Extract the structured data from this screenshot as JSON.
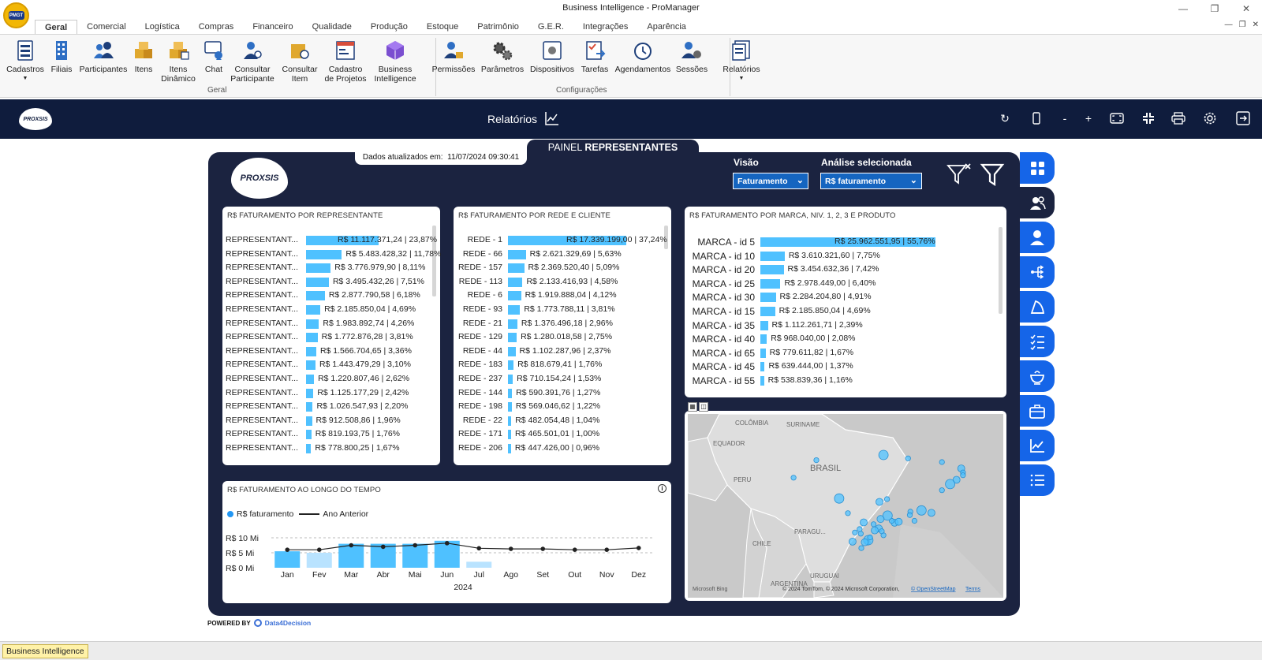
{
  "window": {
    "title": "Business Intelligence - ProManager",
    "logo_text": "PMGT",
    "controls": [
      "minimize",
      "restore",
      "close"
    ]
  },
  "ribbon": {
    "tabs": [
      "Geral",
      "Comercial",
      "Logística",
      "Compras",
      "Financeiro",
      "Qualidade",
      "Produção",
      "Estoque",
      "Patrimônio",
      "G.E.R.",
      "Integrações",
      "Aparência"
    ],
    "active_tab": "Geral",
    "geral_items": [
      {
        "label": "Cadastros",
        "icon": "form-icon",
        "dropdown": true
      },
      {
        "label": "Filiais",
        "icon": "building-icon"
      },
      {
        "label": "Participantes",
        "icon": "people-icon"
      },
      {
        "label": "Itens",
        "icon": "boxes-icon"
      },
      {
        "label": "Itens\nDinâmico",
        "icon": "boxes-grid-icon"
      },
      {
        "label": "Chat",
        "icon": "chat-icon"
      },
      {
        "label": "Consultar\nParticipante",
        "icon": "person-search-icon"
      },
      {
        "label": "Consultar\nItem",
        "icon": "box-search-icon"
      },
      {
        "label": "Cadastro\nde Projetos",
        "icon": "projects-icon"
      },
      {
        "label": "Business\nIntelligence",
        "icon": "bi-cube-icon"
      }
    ],
    "geral_group_label": "Geral",
    "config_items": [
      {
        "label": "Permissões",
        "icon": "permissions-icon"
      },
      {
        "label": "Parâmetros",
        "icon": "gears-icon"
      },
      {
        "label": "Dispositivos",
        "icon": "device-icon"
      },
      {
        "label": "Tarefas",
        "icon": "tasks-icon"
      },
      {
        "label": "Agendamentos",
        "icon": "alarm-clock-icon"
      },
      {
        "label": "Sessões",
        "icon": "sessions-icon"
      }
    ],
    "config_group_label": "Configurações",
    "reports_item": {
      "label": "Relatórios",
      "icon": "reports-icon",
      "dropdown": true
    }
  },
  "bi_header": {
    "logo_text": "PROXSIS",
    "title": "Relatórios",
    "tools": [
      "refresh-icon",
      "mobile-icon",
      "zoom-out-icon",
      "zoom-in-icon",
      "fit-screen-icon",
      "collapse-icon",
      "print-icon",
      "settings-icon",
      "exit-icon"
    ],
    "zoom_out_label": "-",
    "zoom_in_label": "+"
  },
  "report": {
    "panel_title_prefix": "PAINEL ",
    "panel_title_bold": "REPRESENTANTES",
    "updated_label": "Dados atualizados em:",
    "updated_value": "11/07/2024 09:30:41",
    "logo_text": "PROXSIS",
    "visao_label": "Visão",
    "visao_value": "Faturamento",
    "analise_label": "Análise selecionada",
    "analise_value": "R$ faturamento",
    "powered_label": "POWERED BY",
    "powered_brand": "Data4Decision"
  },
  "charts": {
    "rep": {
      "title": "R$ FATURAMENTO POR REPRESENTANTE",
      "rows": [
        {
          "label": "REPRESENTANT...",
          "value": "R$ 11.117.371,24 | 23,87%",
          "pct": 23.87
        },
        {
          "label": "REPRESENTANT...",
          "value": "R$ 5.483.428,32 | 11,78%",
          "pct": 11.78
        },
        {
          "label": "REPRESENTANT...",
          "value": "R$ 3.776.979,90 | 8,11%",
          "pct": 8.11
        },
        {
          "label": "REPRESENTANT...",
          "value": "R$ 3.495.432,26 | 7,51%",
          "pct": 7.51
        },
        {
          "label": "REPRESENTANT...",
          "value": "R$ 2.877.790,58 | 6,18%",
          "pct": 6.18
        },
        {
          "label": "REPRESENTANT...",
          "value": "R$ 2.185.850,04 | 4,69%",
          "pct": 4.69
        },
        {
          "label": "REPRESENTANT...",
          "value": "R$ 1.983.892,74 | 4,26%",
          "pct": 4.26
        },
        {
          "label": "REPRESENTANT...",
          "value": "R$ 1.772.876,28 | 3,81%",
          "pct": 3.81
        },
        {
          "label": "REPRESENTANT...",
          "value": "R$ 1.566.704,65 | 3,36%",
          "pct": 3.36
        },
        {
          "label": "REPRESENTANT...",
          "value": "R$ 1.443.479,29 | 3,10%",
          "pct": 3.1
        },
        {
          "label": "REPRESENTANT...",
          "value": "R$ 1.220.807,46 | 2,62%",
          "pct": 2.62
        },
        {
          "label": "REPRESENTANT...",
          "value": "R$ 1.125.177,29 | 2,42%",
          "pct": 2.42
        },
        {
          "label": "REPRESENTANT...",
          "value": "R$ 1.026.547,93 | 2,20%",
          "pct": 2.2
        },
        {
          "label": "REPRESENTANT...",
          "value": "R$ 912.508,86 | 1,96%",
          "pct": 1.96
        },
        {
          "label": "REPRESENTANT...",
          "value": "R$ 819.193,75 | 1,76%",
          "pct": 1.76
        },
        {
          "label": "REPRESENTANT...",
          "value": "R$ 778.800,25 | 1,67%",
          "pct": 1.67
        }
      ]
    },
    "rede": {
      "title": "R$ FATURAMENTO POR REDE E CLIENTE",
      "rows": [
        {
          "label": "REDE - 1",
          "value": "R$ 17.339.199,00 | 37,24%",
          "pct": 37.24
        },
        {
          "label": "REDE - 66",
          "value": "R$ 2.621.329,69 | 5,63%",
          "pct": 5.63
        },
        {
          "label": "REDE - 157",
          "value": "R$ 2.369.520,40 | 5,09%",
          "pct": 5.09
        },
        {
          "label": "REDE - 113",
          "value": "R$ 2.133.416,93 | 4,58%",
          "pct": 4.58
        },
        {
          "label": "REDE - 6",
          "value": "R$ 1.919.888,04 | 4,12%",
          "pct": 4.12
        },
        {
          "label": "REDE - 93",
          "value": "R$ 1.773.788,11 | 3,81%",
          "pct": 3.81
        },
        {
          "label": "REDE - 21",
          "value": "R$ 1.376.496,18 | 2,96%",
          "pct": 2.96
        },
        {
          "label": "REDE - 129",
          "value": "R$ 1.280.018,58 | 2,75%",
          "pct": 2.75
        },
        {
          "label": "REDE - 44",
          "value": "R$ 1.102.287,96 | 2,37%",
          "pct": 2.37
        },
        {
          "label": "REDE - 183",
          "value": "R$ 818.679,41 | 1,76%",
          "pct": 1.76
        },
        {
          "label": "REDE - 237",
          "value": "R$ 710.154,24 | 1,53%",
          "pct": 1.53
        },
        {
          "label": "REDE - 144",
          "value": "R$ 590.391,76 | 1,27%",
          "pct": 1.27
        },
        {
          "label": "REDE - 198",
          "value": "R$ 569.046,62 | 1,22%",
          "pct": 1.22
        },
        {
          "label": "REDE - 22",
          "value": "R$ 482.054,48 | 1,04%",
          "pct": 1.04
        },
        {
          "label": "REDE - 171",
          "value": "R$ 465.501,01 | 1,00%",
          "pct": 1.0
        },
        {
          "label": "REDE - 206",
          "value": "R$ 447.426,00 | 0,96%",
          "pct": 0.96
        }
      ]
    },
    "marca": {
      "title": "R$ FATURAMENTO POR MARCA, NIV. 1, 2, 3 E PRODUTO",
      "rows": [
        {
          "label": "MARCA - id 5",
          "value": "R$ 25.962.551,95 | 55,76%",
          "pct": 55.76
        },
        {
          "label": "MARCA - id 10",
          "value": "R$ 3.610.321,60 | 7,75%",
          "pct": 7.75
        },
        {
          "label": "MARCA - id 20",
          "value": "R$ 3.454.632,36 | 7,42%",
          "pct": 7.42
        },
        {
          "label": "MARCA - id 25",
          "value": "R$ 2.978.449,00 | 6,40%",
          "pct": 6.4
        },
        {
          "label": "MARCA - id 30",
          "value": "R$ 2.284.204,80 | 4,91%",
          "pct": 4.91
        },
        {
          "label": "MARCA - id 15",
          "value": "R$ 2.185.850,04 | 4,69%",
          "pct": 4.69
        },
        {
          "label": "MARCA - id 35",
          "value": "R$ 1.112.261,71 | 2,39%",
          "pct": 2.39
        },
        {
          "label": "MARCA - id 40",
          "value": "R$ 968.040,00 | 2,08%",
          "pct": 2.08
        },
        {
          "label": "MARCA - id 65",
          "value": "R$ 779.611,82 | 1,67%",
          "pct": 1.67
        },
        {
          "label": "MARCA - id 45",
          "value": "R$ 639.444,00 | 1,37%",
          "pct": 1.37
        },
        {
          "label": "MARCA - id 55",
          "value": "R$ 538.839,36 | 1,16%",
          "pct": 1.16
        }
      ]
    },
    "map": {
      "labels": {
        "colombia": "COLÔMBIA",
        "suriname": "SURINAME",
        "equador": "EQUADOR",
        "brasil": "BRASIL",
        "peru": "PERU",
        "paraguai": "PARAGU...",
        "chile": "CHILE",
        "uruguai": "URUGUAI",
        "argentina": "ARGENTINA"
      },
      "credit": "© 2024 TomTom, © 2024 Microsoft Corporation,",
      "osm": "© OpenStreetMap",
      "terms": "Terms",
      "bing": "Microsoft Bing",
      "points": [
        {
          "lon": -48.5,
          "lat": -1.4
        },
        {
          "lon": -44.3,
          "lat": -2.5
        },
        {
          "lon": -38.5,
          "lat": -3.7
        },
        {
          "lon": -35.2,
          "lat": -5.8
        },
        {
          "lon": -34.9,
          "lat": -7.1
        },
        {
          "lon": -34.9,
          "lat": -8.0
        },
        {
          "lon": -36.0,
          "lat": -9.5
        },
        {
          "lon": -37.1,
          "lat": -10.9
        },
        {
          "lon": -38.5,
          "lat": -12.9
        },
        {
          "lon": -40.3,
          "lat": -20.3
        },
        {
          "lon": -43.2,
          "lat": -22.9
        },
        {
          "lon": -43.9,
          "lat": -19.9
        },
        {
          "lon": -46.6,
          "lat": -23.5
        },
        {
          "lon": -47.1,
          "lat": -22.9
        },
        {
          "lon": -47.8,
          "lat": -21.2
        },
        {
          "lon": -49.3,
          "lat": -25.4
        },
        {
          "lon": -48.5,
          "lat": -27.6
        },
        {
          "lon": -51.2,
          "lat": -30.0
        },
        {
          "lon": -49.2,
          "lat": -16.7
        },
        {
          "lon": -47.9,
          "lat": -15.8
        },
        {
          "lon": -54.6,
          "lat": -20.4
        },
        {
          "lon": -56.1,
          "lat": -15.6
        },
        {
          "lon": -60.0,
          "lat": -3.1
        },
        {
          "lon": -63.9,
          "lat": -8.8
        },
        {
          "lon": -51.9,
          "lat": -23.4
        },
        {
          "lon": -50.2,
          "lat": -24.0
        },
        {
          "lon": -52.4,
          "lat": -27.1
        },
        {
          "lon": -53.8,
          "lat": -29.7
        },
        {
          "lon": -51.1,
          "lat": -29.2
        },
        {
          "lon": -52.3,
          "lat": -31.8
        },
        {
          "lon": -50.0,
          "lat": -26.0
        },
        {
          "lon": -48.8,
          "lat": -26.3
        },
        {
          "lon": -50.8,
          "lat": -28.3
        },
        {
          "lon": -45.9,
          "lat": -23.2
        },
        {
          "lon": -44.0,
          "lat": -21.0
        },
        {
          "lon": -42.0,
          "lat": -19.5
        },
        {
          "lon": -49.0,
          "lat": -22.3
        },
        {
          "lon": -52.6,
          "lat": -25.6
        },
        {
          "lon": -53.4,
          "lat": -26.7
        },
        {
          "lon": -51.7,
          "lat": -29.9
        }
      ]
    },
    "timeline": {
      "title": "R$ FATURAMENTO AO LONGO DO TEMPO",
      "legend_current": "R$ faturamento",
      "legend_previous": "Ano Anterior",
      "y_ticks": [
        "R$ 10 Mi",
        "R$ 5 Mi",
        "R$ 0 Mi"
      ],
      "year": "2024"
    }
  },
  "statusbar": {
    "item": "Business Intelligence"
  },
  "chart_data": [
    {
      "type": "bar",
      "title": "R$ FATURAMENTO AO LONGO DO TEMPO",
      "categories": [
        "Jan",
        "Fev",
        "Mar",
        "Abr",
        "Mai",
        "Jun",
        "Jul",
        "Ago",
        "Set",
        "Out",
        "Nov",
        "Dez"
      ],
      "xlabel": "2024",
      "ylim": [
        0,
        10
      ],
      "series": [
        {
          "name": "R$ faturamento",
          "values": [
            5.5,
            5.0,
            8.0,
            8.0,
            8.0,
            9.0,
            2.0,
            null,
            null,
            null,
            null,
            null
          ],
          "faded": [
            false,
            true,
            false,
            false,
            false,
            false,
            true,
            false,
            false,
            false,
            false,
            false
          ]
        },
        {
          "name": "Ano Anterior",
          "type": "line",
          "values": [
            6.0,
            6.0,
            7.5,
            7.0,
            7.5,
            8.2,
            6.5,
            6.3,
            6.3,
            6.0,
            6.0,
            6.6
          ]
        }
      ]
    }
  ]
}
